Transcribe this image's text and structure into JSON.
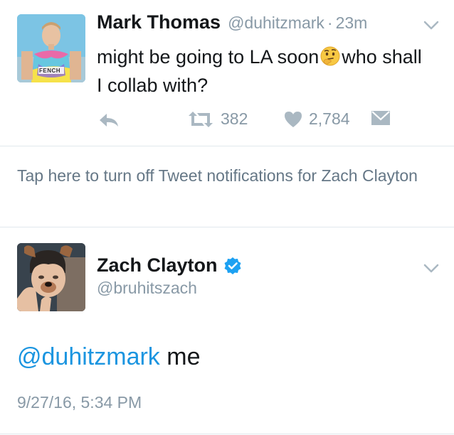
{
  "tweet1": {
    "name": "Mark Thomas",
    "handle": "@duhitzmark",
    "separator": "·",
    "time": "23m",
    "text_before_emoji": "might be going to LA soon",
    "emoji": "thinking-face-emoji",
    "text_after_emoji": "who shall I collab with?",
    "avatar_shirt_text": "FENCH",
    "retweets": "382",
    "likes": "2,784"
  },
  "notice": {
    "text": "Tap here to turn off Tweet notifications for Zach Clayton"
  },
  "tweet2": {
    "name": "Zach Clayton",
    "handle": "@bruhitszach",
    "mention": "@duhitzmark",
    "text": " me",
    "date": "9/27/16, 5:34 PM"
  },
  "colors": {
    "link": "#1b95e0",
    "secondary": "#8899a6",
    "separator": "#e1e8ed",
    "verified": "#1da1f2"
  }
}
